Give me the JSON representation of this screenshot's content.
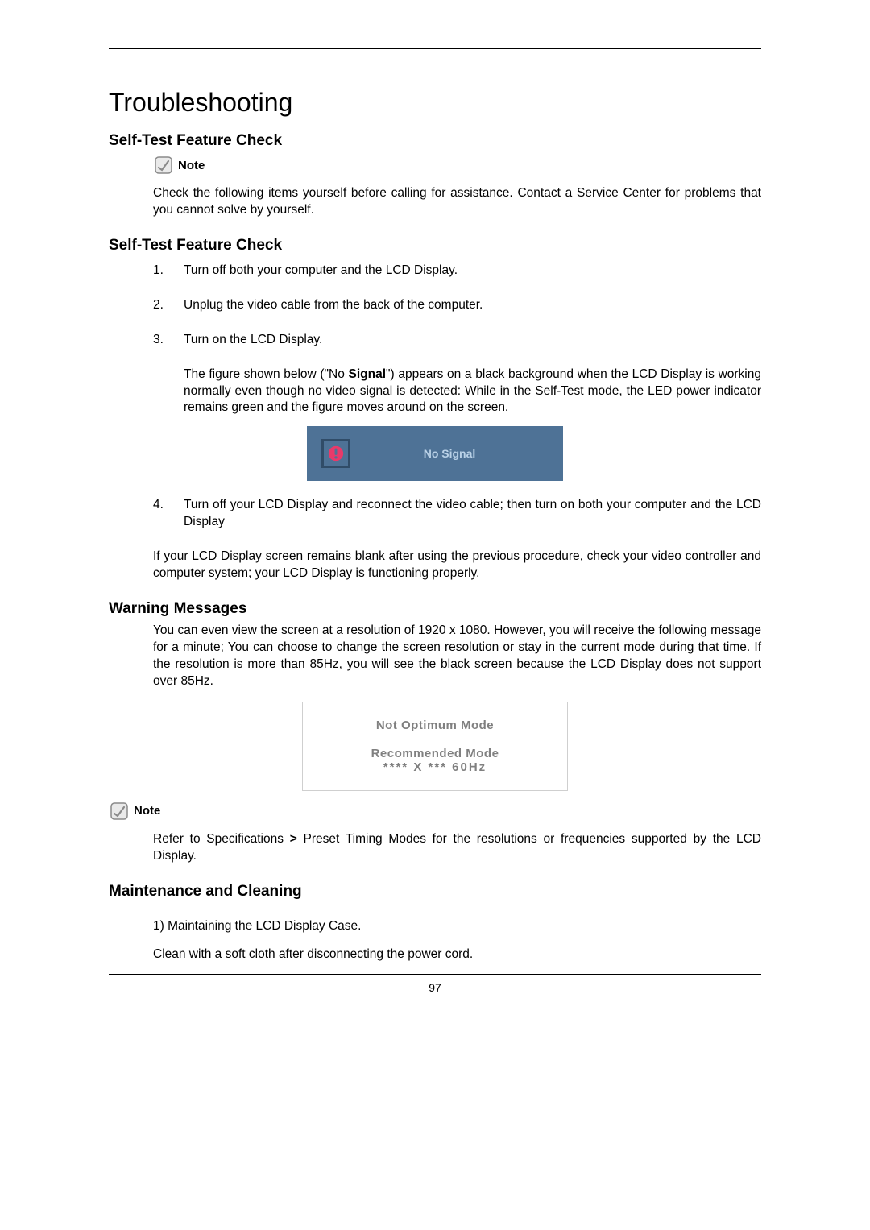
{
  "title": "Troubleshooting",
  "section1": {
    "heading": "Self-Test Feature Check",
    "noteLabel": "Note",
    "notePara": "Check the following items yourself before calling for assistance. Contact a Service Center for problems that you cannot solve by yourself."
  },
  "section2": {
    "heading": "Self-Test Feature Check",
    "items": {
      "n1": "1.",
      "t1": "Turn off both your computer and the LCD Display.",
      "n2": "2.",
      "t2": "Unplug the video cable from the back of the computer.",
      "n3": "3.",
      "t3": "Turn on the LCD Display.",
      "sub3a": "The figure shown below (\"No ",
      "sub3signal": "Signal",
      "sub3b": "\") appears on a black background when the LCD Display is working normally even though no video signal is detected: While in the Self-Test mode, the LED power indicator remains green and the figure moves around on the screen.",
      "noSignalText": "No Signal",
      "n4": "4.",
      "t4": "Turn off your LCD Display and reconnect the video cable; then turn on both your computer and the LCD Display",
      "closing": "If your LCD Display screen remains blank after using the previous procedure, check your video controller and computer system; your LCD Display is functioning properly."
    }
  },
  "section3": {
    "heading": "Warning Messages",
    "para": "You can even view the screen at a resolution of 1920 x 1080. However, you will receive the following message for a minute; You can choose to change the screen resolution or stay in the current mode during that time. If the resolution is more than 85Hz, you will see the black screen because the LCD Display does not support over 85Hz.",
    "modeBox": {
      "line1": "Not Optimum Mode",
      "line2": "Recommended Mode",
      "line3": "**** X *** 60Hz"
    },
    "noteLabel": "Note",
    "notePara_a": "Refer to Specifications ",
    "notePara_gt": ">",
    "notePara_b": " Preset Timing Modes for the resolutions or frequencies supported by the LCD Display."
  },
  "section4": {
    "heading": "Maintenance and Cleaning",
    "p1": "1) Maintaining the LCD Display Case.",
    "p2": "Clean with a soft cloth after disconnecting the power cord."
  },
  "pageNumber": "97"
}
